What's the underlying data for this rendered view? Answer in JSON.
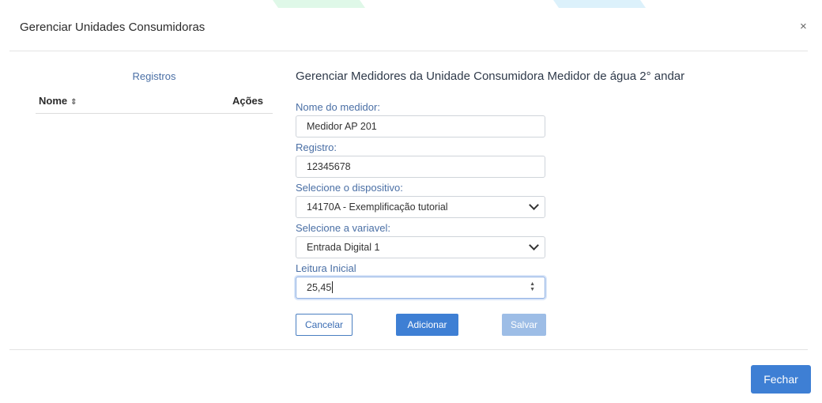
{
  "modal": {
    "title": "Gerenciar Unidades Consumidoras",
    "close_symbol": "×"
  },
  "registros": {
    "caption": "Registros",
    "columns": {
      "nome": "Nome",
      "nome_sort_icon": "⇕",
      "acoes": "Ações"
    },
    "rows": []
  },
  "form": {
    "title": "Gerenciar Medidores da Unidade Consumidora Medidor de água 2° andar",
    "nome_label": "Nome do medidor:",
    "nome_value": "Medidor AP 201",
    "registro_label": "Registro:",
    "registro_value": "12345678",
    "dispositivo_label": "Selecione o dispositivo:",
    "dispositivo_value": "14170A - Exemplificação tutorial",
    "variavel_label": "Selecione a variavel:",
    "variavel_value": "Entrada Digital 1",
    "leitura_label": "Leitura Inicial",
    "leitura_value": "25,45",
    "buttons": {
      "cancel": "Cancelar",
      "add": "Adicionar",
      "save": "Salvar"
    }
  },
  "footer": {
    "close_button": "Fechar"
  },
  "colors": {
    "primary": "#3e7fd4",
    "primary_disabled": "#9dbde6",
    "label": "#4a6fa5"
  }
}
